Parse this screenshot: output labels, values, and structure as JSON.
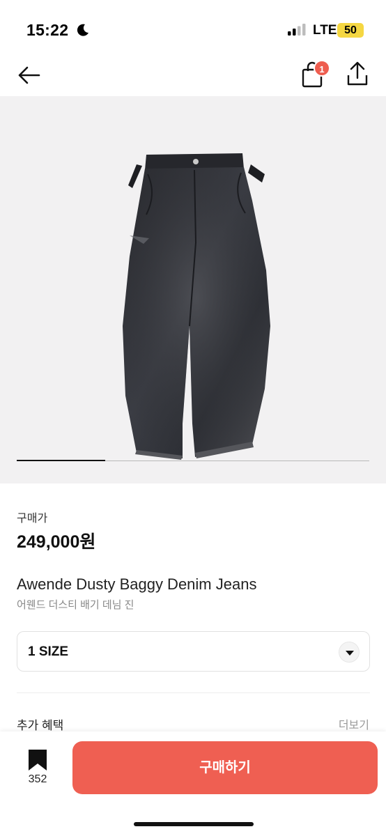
{
  "status_bar": {
    "time": "15:22",
    "network": "LTE",
    "battery": "50",
    "icons": [
      "moon-icon",
      "signal-icon"
    ]
  },
  "nav": {
    "icons": [
      "back-arrow-icon",
      "shopping-bag-icon",
      "share-icon"
    ],
    "cart_badge": "1"
  },
  "gallery": {
    "image": "black baggy denim jeans photo",
    "current_slide": 1,
    "total_slides": 4
  },
  "product": {
    "price_label": "구매가",
    "price": "249,000원",
    "name_en": "Awende Dusty Baggy Denim Jeans",
    "name_ko": "어웬드 더스티 배기 데님 진"
  },
  "options": {
    "size_selected": "1 SIZE"
  },
  "benefits": {
    "label": "추가 혜택",
    "more": "더보기"
  },
  "bottom_bar": {
    "bookmark_count": "352",
    "buy_label": "구매하기"
  },
  "colors": {
    "accent": "#ef5f52",
    "badge": "#ee5d4f",
    "battery": "#f5d742",
    "image_bg": "#f2f1f2"
  }
}
